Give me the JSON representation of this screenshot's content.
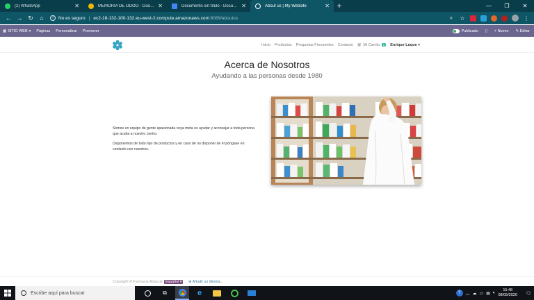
{
  "browser": {
    "tabs": [
      {
        "title": "(2) WhatsApp",
        "active": false,
        "favicon_color": "#25d366"
      },
      {
        "title": "MEMORIA DE ODOO - Google D",
        "active": false,
        "favicon_color": "#f4b400"
      },
      {
        "title": "Documento sin título - Docume",
        "active": false,
        "favicon_color": "#4285f4"
      },
      {
        "title": "About us | My Website",
        "active": true,
        "favicon_color": "#ffffff"
      }
    ],
    "address": {
      "security_label": "No es seguro",
      "host": "ec2-18-132-100-132.eu-west-2.compute.amazonaws.com",
      "path": ":8069/aboutus"
    }
  },
  "admin_bar": {
    "site_menu": "SITIO WEB",
    "pages": "Páginas",
    "customize": "Personalizar",
    "promote": "Promover",
    "published": "Publicado",
    "new": "+ Nuevo",
    "edit": "Editar"
  },
  "site_nav": {
    "items": [
      "Inicio",
      "Productos",
      "Preguntas Frecuentes",
      "Contacto"
    ],
    "cart_label": "Mi Carrito",
    "cart_count": "0",
    "user": "Enrique Luque"
  },
  "page": {
    "title": "Acerca de Nosotros",
    "subtitle": "Ayudando a las personas desde 1980",
    "paragraph1": "Somos un equipo de gente apasionada cuya meta es ayudar y aconsejar a toda persona que acuda a nuestro centro.",
    "paragraph2": "Disponemos de todo tipo de productos y en caso de no disponer de él póngase en contacto con nosotros."
  },
  "footer": {
    "copyright": "Copyright © Farmacia Abascal",
    "language": "Español",
    "add_language": "Añadir un idioma..."
  },
  "taskbar": {
    "search_placeholder": "Escribe aquí para buscar",
    "time": "15:48",
    "date": "08/05/2020"
  },
  "colors": {
    "admin_bar": "#6b6690",
    "browser_frame": "#0e5566",
    "accent": "#21b799"
  }
}
